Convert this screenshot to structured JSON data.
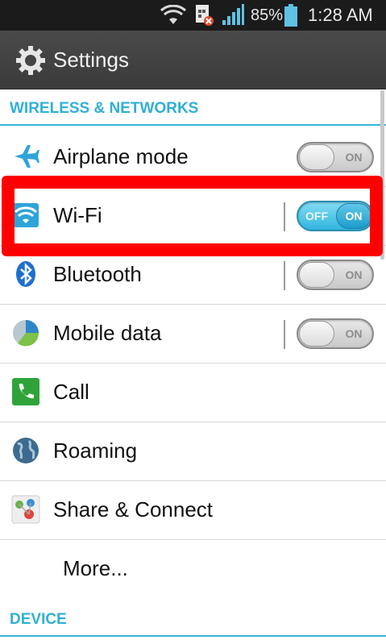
{
  "status_bar": {
    "battery_percent": "85%",
    "time": "1:28 AM",
    "icons": [
      "wifi-icon",
      "sim-error-icon",
      "signal-icon",
      "battery-icon"
    ]
  },
  "action_bar": {
    "title": "Settings",
    "icon": "gear-icon"
  },
  "sections": {
    "wireless": "WIRELESS & NETWORKS",
    "device": "DEVICE"
  },
  "rows": [
    {
      "label": "Airplane mode",
      "icon": "airplane-icon",
      "toggle": "off"
    },
    {
      "label": "Wi-Fi",
      "icon": "wifi-icon",
      "toggle": "on"
    },
    {
      "label": "Bluetooth",
      "icon": "bluetooth-icon",
      "toggle": "off"
    },
    {
      "label": "Mobile data",
      "icon": "mobile-data-icon",
      "toggle": "off"
    },
    {
      "label": "Call",
      "icon": "phone-icon"
    },
    {
      "label": "Roaming",
      "icon": "globe-icon"
    },
    {
      "label": "Share & Connect",
      "icon": "share-connect-icon"
    },
    {
      "label": "More..."
    }
  ],
  "toggle_text": {
    "off": "OFF",
    "on": "ON"
  },
  "colors": {
    "accent": "#2fb0d6",
    "highlight": "#ff0000",
    "status_bar": "#1b1b1b",
    "action_bar": "#424242"
  }
}
